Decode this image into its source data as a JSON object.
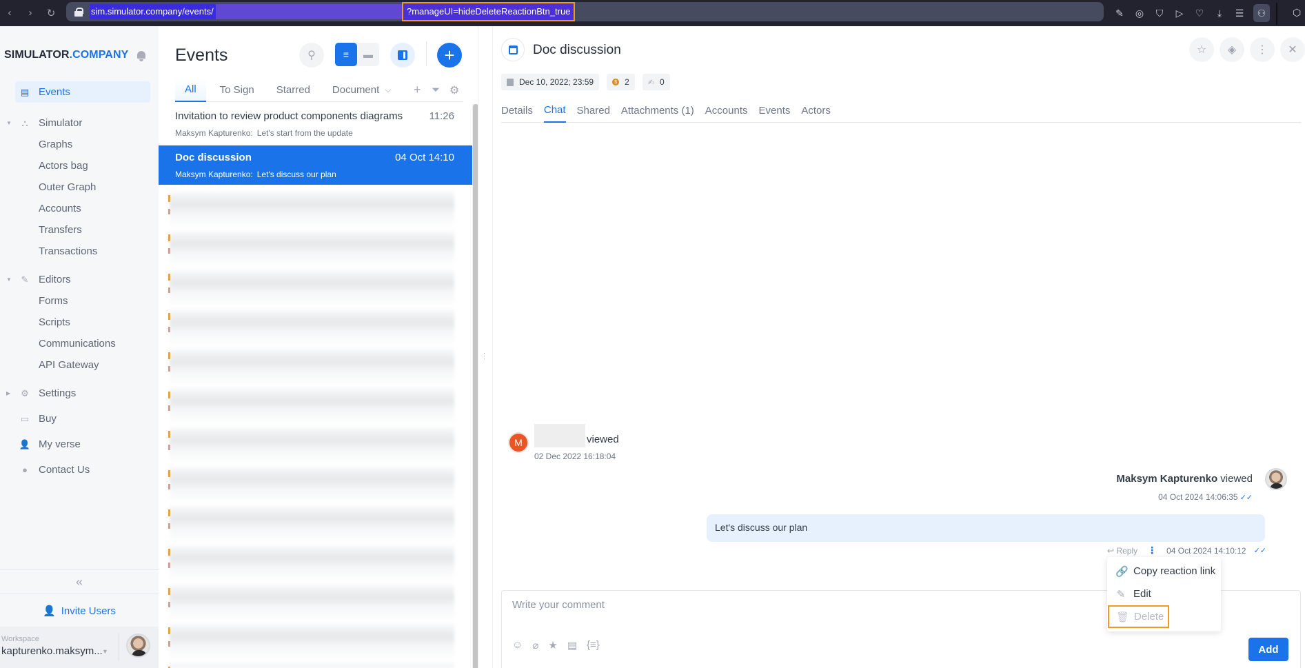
{
  "browser": {
    "url_visible": "sim.simulator.company/events/",
    "url_param": "?manageUI=hideDeleteReactionBtn_true",
    "toolbar_icons": [
      "edit-icon",
      "camera-icon",
      "shield-icon",
      "send-icon",
      "heart-icon",
      "download-icon",
      "sliders-icon",
      "profile-icon",
      "extension-icon"
    ]
  },
  "sidebar": {
    "logo_main": "SIMULATOR",
    "logo_accent": ".COMPANY",
    "items": [
      {
        "label": "Events",
        "icon": "events-icon",
        "active": true
      },
      {
        "label": "Simulator",
        "icon": "simulator-icon",
        "expanded": true
      },
      {
        "label": "Graphs",
        "sub": true
      },
      {
        "label": "Actors bag",
        "sub": true
      },
      {
        "label": "Outer Graph",
        "sub": true
      },
      {
        "label": "Accounts",
        "sub": true
      },
      {
        "label": "Transfers",
        "sub": true
      },
      {
        "label": "Transactions",
        "sub": true
      },
      {
        "label": "Editors",
        "icon": "pencil-icon",
        "expanded": true
      },
      {
        "label": "Forms",
        "sub": true
      },
      {
        "label": "Scripts",
        "sub": true
      },
      {
        "label": "Communications",
        "sub": true
      },
      {
        "label": "API Gateway",
        "sub": true
      },
      {
        "label": "Settings",
        "icon": "gear-icon",
        "expanded": false
      },
      {
        "label": "Buy",
        "icon": "wallet-icon"
      },
      {
        "label": "My verse",
        "icon": "user-icon"
      },
      {
        "label": "Contact Us",
        "icon": "chat-icon"
      }
    ],
    "collapse_label": "«",
    "invite_label": "Invite Users",
    "workspace_label": "Workspace",
    "workspace_value": "kapturenko.maksym..."
  },
  "events": {
    "title": "Events",
    "tabs": [
      "All",
      "To Sign",
      "Starred",
      "Document"
    ],
    "active_tab": "All",
    "items": [
      {
        "name": "Invitation to review product components diagrams",
        "time": "11:26",
        "author": "Maksym Kapturenko:",
        "snippet": "Let's start from the update",
        "selected": false
      },
      {
        "name": "Doc discussion",
        "time": "04 Oct 14:10",
        "author": "Maksym Kapturenko:",
        "snippet": "Let's discuss our plan",
        "selected": true
      }
    ]
  },
  "detail": {
    "title": "Doc discussion",
    "date_chip": "Dec 10, 2022; 23:59",
    "coin_count": "2",
    "sign_count": "0",
    "tabs": [
      "Details",
      "Chat",
      "Shared",
      "Attachments (1)",
      "Accounts",
      "Events",
      "Actors"
    ],
    "active_tab": "Chat"
  },
  "chat": {
    "first": {
      "avatar_letter": "M",
      "action": "viewed",
      "time": "02 Dec 2022 16:18:04"
    },
    "second": {
      "author": "Maksym Kapturenko",
      "action": "viewed",
      "time": "04 Oct 2024 14:06:35"
    },
    "message": {
      "text": "Let's discuss our plan",
      "reply_label": "Reply",
      "time": "04 Oct 2024 14:10:12"
    },
    "context_menu": [
      {
        "label": "Copy reaction link",
        "icon": "link-icon",
        "disabled": false
      },
      {
        "label": "Edit",
        "icon": "pencil-icon",
        "disabled": false
      },
      {
        "label": "Delete",
        "icon": "trash-icon",
        "disabled": true
      }
    ],
    "composer_placeholder": "Write your comment",
    "add_label": "Add"
  }
}
